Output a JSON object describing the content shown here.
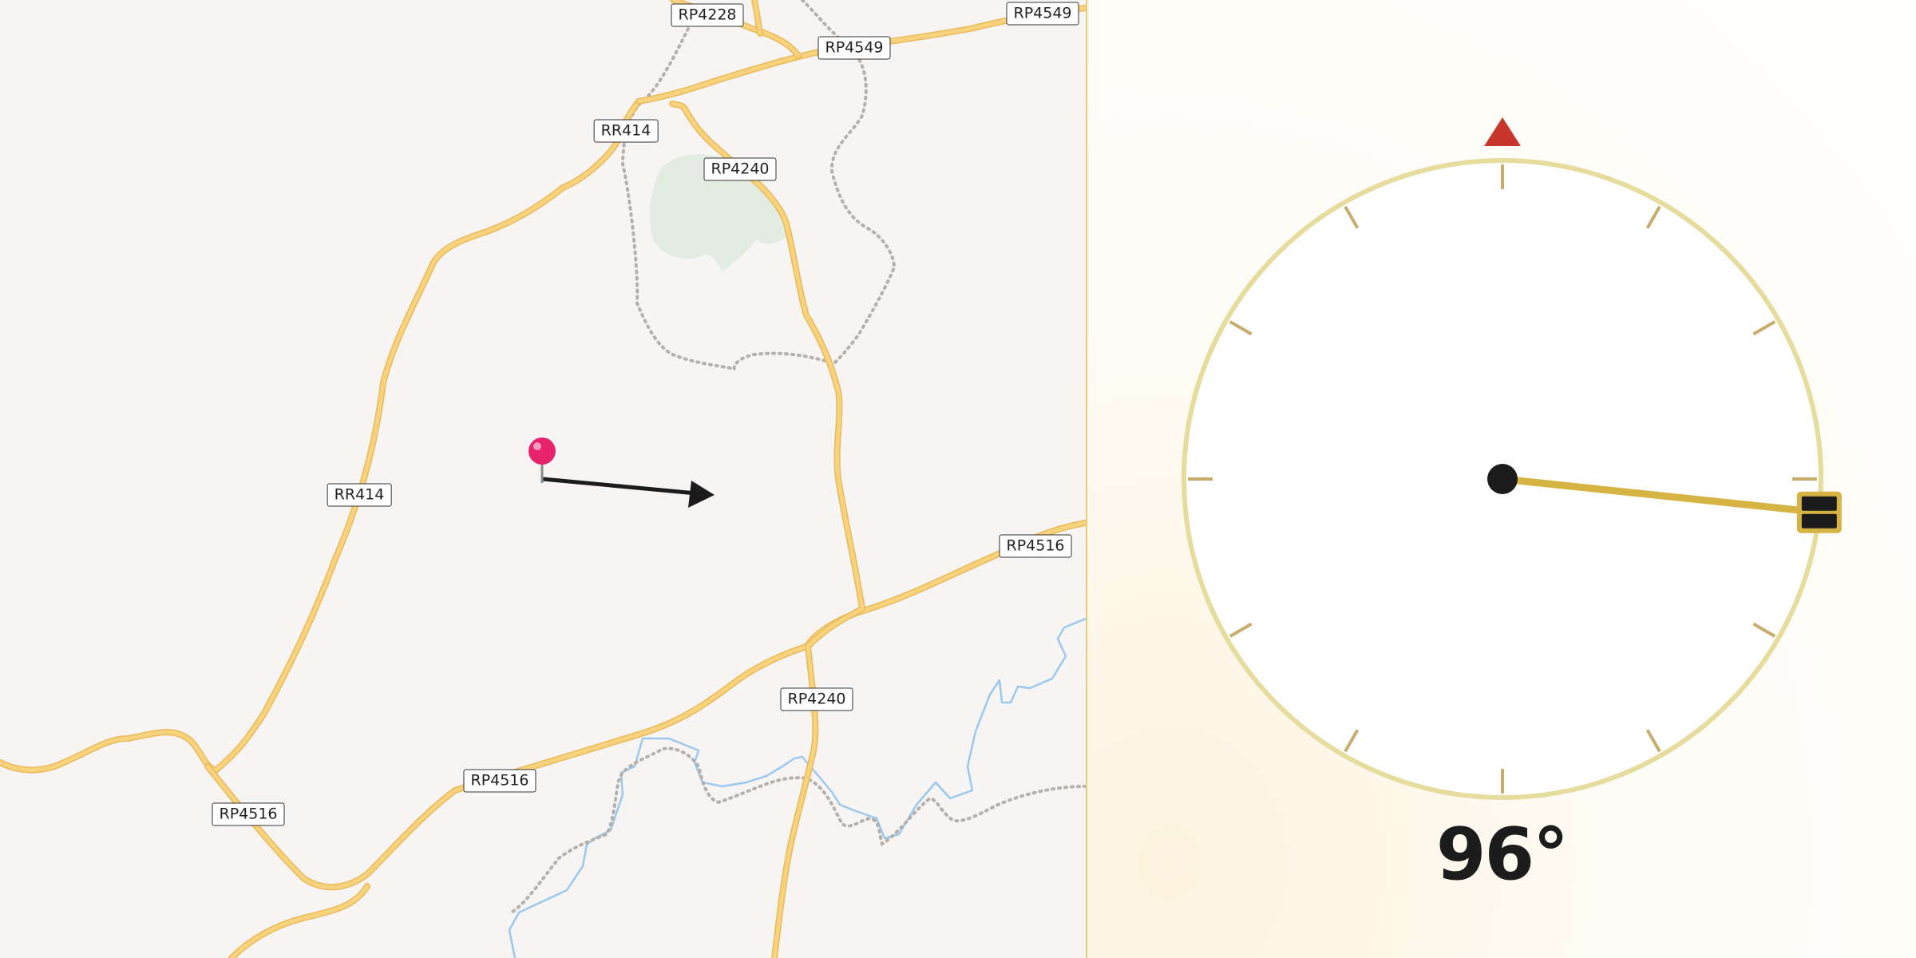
{
  "map": {
    "background_color": "#f7f5f3",
    "road_color": "#f5c96b",
    "water_color": "#9cc8ee",
    "park_color": "#e3ece0",
    "boundary_color": "#b5b0aa",
    "road_labels": [
      "RP4228",
      "RP4549",
      "RP4549",
      "RR414",
      "RP4240",
      "RR414",
      "RP4516",
      "RP4240",
      "RP4516",
      "RP4516"
    ],
    "pin_icon": "map-pin-icon",
    "pin_color": "#e8236e",
    "heading_arrow_icon": "heading-arrow-icon"
  },
  "dial": {
    "north_marker_icon": "north-triangle-icon",
    "north_marker_color": "#c8362b",
    "ring_color": "#e6dc9e",
    "tick_color": "#c8ad6c",
    "needle_color": "#d6b443",
    "handle_icon": "drag-handle-icon",
    "handle_color": "#1c1c1c",
    "heading_degrees": 96,
    "heading_text": "96°"
  }
}
